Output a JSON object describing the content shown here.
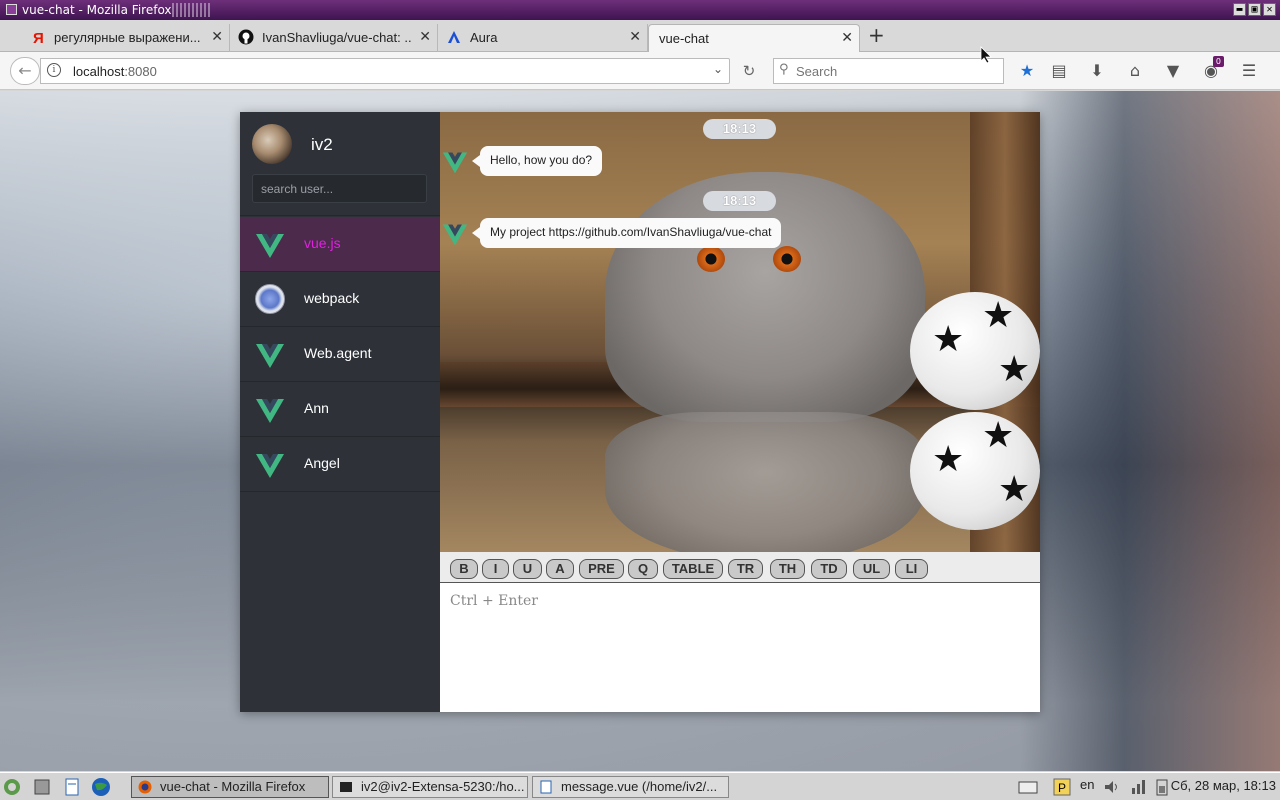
{
  "window": {
    "title": "vue-chat - Mozilla Firefox",
    "btn_min": "▬",
    "btn_max": "▣",
    "btn_close": "✕"
  },
  "tabs": [
    {
      "label": "регулярные выражени...",
      "icon": "yandex-icon"
    },
    {
      "label": "IvanShavliuga/vue-chat: ...",
      "icon": "github-icon"
    },
    {
      "label": "Aura",
      "icon": "aura-icon"
    },
    {
      "label": "vue-chat",
      "icon": ""
    }
  ],
  "tab_close": "✕",
  "new_tab": "+",
  "nav": {
    "url_host": "localhost",
    "url_port": ":8080",
    "search_placeholder": "Search",
    "notification_count": "0"
  },
  "sidebar": {
    "me": {
      "name": "iv2"
    },
    "search_placeholder": "search user...",
    "users": [
      {
        "name": "vue.js",
        "avatar": "vue-logo",
        "active": true
      },
      {
        "name": "webpack",
        "avatar": "webpack-logo",
        "active": false
      },
      {
        "name": "Web.agent",
        "avatar": "vue-logo",
        "active": false
      },
      {
        "name": "Ann",
        "avatar": "vue-logo",
        "active": false
      },
      {
        "name": "Angel",
        "avatar": "vue-logo",
        "active": false
      }
    ]
  },
  "messages": [
    {
      "time": "18:13",
      "text": "Hello, how you do?"
    },
    {
      "time": "18:13",
      "text": "My project https://github.com/IvanShavliuga/vue-chat"
    }
  ],
  "format_buttons": [
    "B",
    "I",
    "U",
    "A",
    "PRE",
    "Q",
    "TABLE",
    "TR",
    "TH",
    "TD",
    "UL",
    "LI"
  ],
  "composer": {
    "placeholder": "Ctrl + Enter"
  },
  "taskbar": {
    "tasks": [
      {
        "label": "vue-chat - Mozilla Firefox",
        "active": true
      },
      {
        "label": "iv2@iv2-Extensa-5230:/ho...",
        "active": false
      },
      {
        "label": "message.vue (/home/iv2/...",
        "active": false
      }
    ],
    "lang": "en",
    "clock": "Сб, 28 мар, 18:13"
  },
  "colors": {
    "sidebar_bg": "#2e3238",
    "active_user_bg": "#4b2a4c",
    "active_user_text": "#e021e0",
    "vue_green": "#41b883",
    "vue_dark": "#35495e"
  }
}
